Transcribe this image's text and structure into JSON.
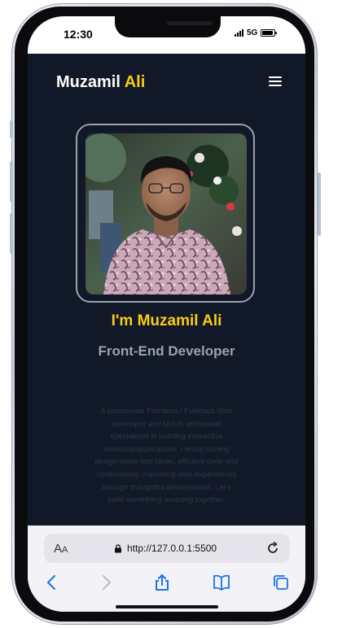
{
  "status_bar": {
    "time": "12:30",
    "network": "5G"
  },
  "site": {
    "brand_first": "Muzamil",
    "brand_accent": "Ali",
    "accent_color": "#facc15",
    "background_color": "#111827",
    "hero_title": "I'm Muzamil Ali",
    "hero_role": "Front-End Developer",
    "hero_description": "A passionate Frontend / Fullstack Web developer and UI/UX enthusiast specialized in building interactive websites/applications. I enjoy turning design ideas into clean, efficient code and continuously improving user experiences through thoughtful development. Let's build something amazing together.",
    "menu_icon": "hamburger-menu-icon"
  },
  "browser": {
    "text_size_label_big": "A",
    "text_size_label_small": "A",
    "url": "http://127.0.0.1:5500",
    "toolbar_icons": [
      "back-icon",
      "forward-icon",
      "share-icon",
      "bookmarks-icon",
      "tabs-icon"
    ],
    "ui_accent_color": "#1a73e8"
  }
}
